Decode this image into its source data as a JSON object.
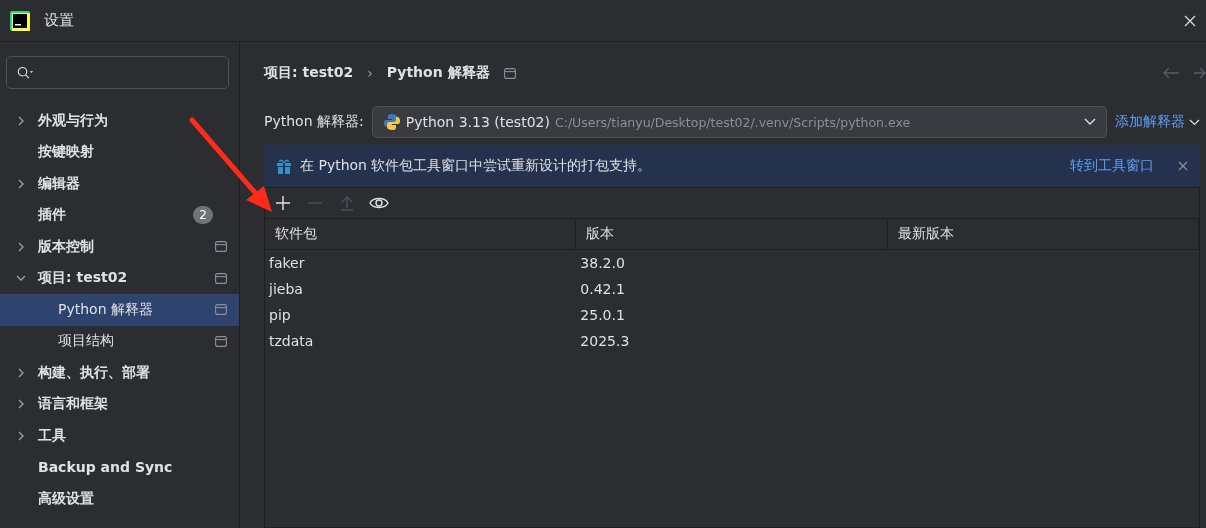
{
  "window": {
    "title": "设置"
  },
  "sidebar": {
    "items": [
      {
        "label": "外观与行为",
        "kind": "group",
        "expanded": false,
        "scope_icon": false
      },
      {
        "label": "按键映射",
        "kind": "leaf",
        "scope_icon": false
      },
      {
        "label": "编辑器",
        "kind": "group",
        "expanded": false,
        "scope_icon": false
      },
      {
        "label": "插件",
        "kind": "leaf",
        "badge": "2",
        "scope_icon": false
      },
      {
        "label": "版本控制",
        "kind": "group",
        "expanded": false,
        "scope_icon": true
      },
      {
        "label": "项目: test02",
        "kind": "group",
        "expanded": true,
        "scope_icon": true,
        "children": [
          {
            "label": "Python 解释器",
            "kind": "leaf",
            "selected": true,
            "scope_icon": true
          },
          {
            "label": "项目结构",
            "kind": "leaf",
            "selected": false,
            "scope_icon": true
          }
        ]
      },
      {
        "label": "构建、执行、部署",
        "kind": "group",
        "expanded": false,
        "scope_icon": false
      },
      {
        "label": "语言和框架",
        "kind": "group",
        "expanded": false,
        "scope_icon": false
      },
      {
        "label": "工具",
        "kind": "group",
        "expanded": false,
        "scope_icon": false
      },
      {
        "label": "Backup and Sync",
        "kind": "leaf",
        "scope_icon": false
      },
      {
        "label": "高级设置",
        "kind": "leaf",
        "scope_icon": false
      }
    ]
  },
  "breadcrumb": {
    "parent": "项目: test02",
    "separator": "›",
    "current": "Python 解释器"
  },
  "interpreter": {
    "label": "Python 解释器:",
    "name": "Python 3.13 (test02)",
    "path": "C:/Users/tianyu/Desktop/test02/.venv/Scripts/python.exe",
    "add_link": "添加解释器"
  },
  "banner": {
    "text": "在 Python 软件包工具窗口中尝试重新设计的打包支持。",
    "link": "转到工具窗口"
  },
  "toolbar": [
    {
      "kind": "add",
      "disabled": false
    },
    {
      "kind": "remove",
      "disabled": true
    },
    {
      "kind": "upgrade",
      "disabled": true
    },
    {
      "kind": "show",
      "disabled": false
    }
  ],
  "table": {
    "columns": [
      "软件包",
      "版本",
      "最新版本"
    ],
    "rows": [
      [
        "faker",
        "38.2.0",
        ""
      ],
      [
        "jieba",
        "0.42.1",
        ""
      ],
      [
        "pip",
        "25.0.1",
        ""
      ],
      [
        "tzdata",
        "2025.3",
        ""
      ]
    ]
  },
  "annotation": {
    "kind": "arrow"
  }
}
